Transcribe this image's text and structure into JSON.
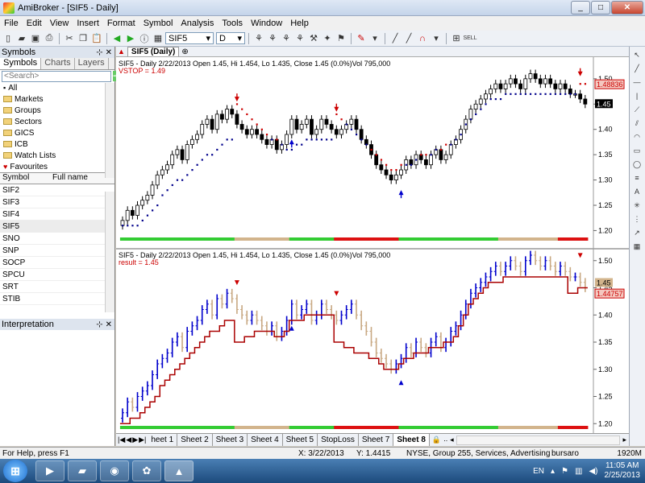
{
  "window": {
    "title": "AmiBroker - [SIF5 - Daily]"
  },
  "menu": [
    "File",
    "Edit",
    "View",
    "Insert",
    "Format",
    "Symbol",
    "Analysis",
    "Tools",
    "Window",
    "Help"
  ],
  "toolbar": {
    "symbol_value": "SIF5",
    "interval_value": "D"
  },
  "symbols_pane": {
    "title": "Symbols",
    "tabs": [
      "Symbols",
      "Charts",
      "Layers"
    ],
    "search_placeholder": "<Search>",
    "tree": [
      "All",
      "Markets",
      "Groups",
      "Sectors",
      "GICS",
      "ICB",
      "Watch Lists",
      "Favourites"
    ],
    "list_headers": [
      "Symbol",
      "Full name"
    ],
    "symbols": [
      "SIF2",
      "SIF3",
      "SIF4",
      "SIF5",
      "SNO",
      "SNP",
      "SOCP",
      "SPCU",
      "SRT",
      "STIB"
    ]
  },
  "interpretation": {
    "title": "Interpretation"
  },
  "doc_tab": "SIF5 (Daily)",
  "sheets": [
    "heet 1",
    "Sheet 2",
    "Sheet 3",
    "Sheet 4",
    "Sheet 5",
    "StopLoss",
    "Sheet 7",
    "Sheet 8"
  ],
  "status": {
    "help": "For Help, press F1",
    "x": "X: 3/22/2013",
    "y": "Y: 1.4415",
    "info": "NYSE, Group 255, Services, Advertising",
    "user": "bursaro",
    "mem": "1920M"
  },
  "taskbar": {
    "lang": "EN",
    "time": "11:05 AM",
    "date": "2/25/2013"
  },
  "colors": {
    "up": "#000000",
    "down": "#000000",
    "stop_up": "#00008b",
    "stop_down": "#cc0000",
    "arrow_up": "#0000cc",
    "arrow_down": "#cc0000",
    "result_line": "#aa0000",
    "bar_blue": "#0000cc",
    "bar_tan": "#c8a882"
  },
  "chart_data": [
    {
      "type": "candlestick",
      "title": "SIF5 - Daily 2/22/2013 Open 1.45, Hi 1.454, Lo 1.435, Close 1.45 (0.0%)Vol 795,000",
      "subtitle": "VSTOP = 1.49",
      "ylim": [
        1.18,
        1.53
      ],
      "yticks": [
        "1.50",
        "1.45",
        "1.40",
        "1.35",
        "1.30",
        "1.25",
        "1.20"
      ],
      "price_labels": [
        "1.48836",
        "1.45"
      ],
      "closes": [
        1.22,
        1.24,
        1.23,
        1.25,
        1.26,
        1.27,
        1.29,
        1.31,
        1.32,
        1.33,
        1.35,
        1.36,
        1.34,
        1.37,
        1.38,
        1.39,
        1.41,
        1.42,
        1.4,
        1.43,
        1.42,
        1.44,
        1.43,
        1.41,
        1.4,
        1.39,
        1.4,
        1.39,
        1.38,
        1.37,
        1.38,
        1.36,
        1.37,
        1.39,
        1.42,
        1.4,
        1.41,
        1.42,
        1.39,
        1.4,
        1.42,
        1.41,
        1.4,
        1.39,
        1.4,
        1.41,
        1.42,
        1.4,
        1.38,
        1.37,
        1.35,
        1.33,
        1.32,
        1.31,
        1.3,
        1.31,
        1.32,
        1.34,
        1.33,
        1.35,
        1.34,
        1.33,
        1.35,
        1.36,
        1.34,
        1.35,
        1.37,
        1.38,
        1.4,
        1.42,
        1.44,
        1.45,
        1.46,
        1.47,
        1.48,
        1.49,
        1.48,
        1.49,
        1.5,
        1.49,
        1.48,
        1.5,
        1.51,
        1.5,
        1.49,
        1.5,
        1.49,
        1.48,
        1.49,
        1.48,
        1.47,
        1.47,
        1.46,
        1.45
      ],
      "vstop_values": [
        1.21,
        1.21,
        1.21,
        1.21,
        1.22,
        1.23,
        1.24,
        1.25,
        1.27,
        1.28,
        1.29,
        1.3,
        1.3,
        1.31,
        1.32,
        1.33,
        1.34,
        1.35,
        1.35,
        1.36,
        1.37,
        1.38,
        1.38,
        1.45,
        1.44,
        1.43,
        1.42,
        1.41,
        1.4,
        1.39,
        1.38,
        1.38,
        1.37,
        1.36,
        1.36,
        1.37,
        1.37,
        1.38,
        1.38,
        1.38,
        1.38,
        1.38,
        1.38,
        1.43,
        1.42,
        1.41,
        1.4,
        1.39,
        1.38,
        1.37,
        1.36,
        1.35,
        1.34,
        1.33,
        1.32,
        1.32,
        1.33,
        1.33,
        1.33,
        1.34,
        1.35,
        1.35,
        1.35,
        1.36,
        1.36,
        1.37,
        1.37,
        1.38,
        1.39,
        1.41,
        1.42,
        1.43,
        1.44,
        1.45,
        1.46,
        1.46,
        1.46,
        1.47,
        1.47,
        1.47,
        1.47,
        1.47,
        1.47,
        1.47,
        1.47,
        1.47,
        1.47,
        1.47,
        1.47,
        1.47,
        1.47,
        1.47,
        1.49,
        1.49
      ],
      "signals": [
        {
          "i": 23,
          "dir": "sell"
        },
        {
          "i": 34,
          "dir": "buy"
        },
        {
          "i": 43,
          "dir": "sell"
        },
        {
          "i": 56,
          "dir": "buy"
        },
        {
          "i": 92,
          "dir": "sell"
        }
      ]
    },
    {
      "type": "bar",
      "title": "SIF5 - Daily 2/22/2013 Open 1.45, Hi 1.454, Lo 1.435, Close 1.45 (0.0%)Vol 795,000",
      "subtitle": "result = 1.45",
      "ylim": [
        1.19,
        1.51
      ],
      "yticks": [
        "1.50",
        "1.45",
        "1.40",
        "1.35",
        "1.30",
        "1.25",
        "1.20"
      ],
      "price_labels": [
        "1.45",
        "1.44757"
      ],
      "result_values": [
        1.2,
        1.2,
        1.21,
        1.21,
        1.22,
        1.23,
        1.24,
        1.25,
        1.27,
        1.28,
        1.29,
        1.3,
        1.31,
        1.32,
        1.33,
        1.34,
        1.35,
        1.36,
        1.37,
        1.37,
        1.38,
        1.39,
        1.39,
        1.35,
        1.35,
        1.36,
        1.36,
        1.37,
        1.37,
        1.37,
        1.37,
        1.36,
        1.36,
        1.37,
        1.39,
        1.39,
        1.39,
        1.4,
        1.4,
        1.4,
        1.4,
        1.4,
        1.4,
        1.35,
        1.35,
        1.34,
        1.34,
        1.33,
        1.33,
        1.33,
        1.32,
        1.32,
        1.31,
        1.3,
        1.3,
        1.3,
        1.31,
        1.32,
        1.32,
        1.33,
        1.33,
        1.33,
        1.34,
        1.34,
        1.34,
        1.35,
        1.35,
        1.36,
        1.38,
        1.4,
        1.42,
        1.43,
        1.44,
        1.45,
        1.46,
        1.46,
        1.46,
        1.47,
        1.47,
        1.47,
        1.47,
        1.47,
        1.47,
        1.47,
        1.47,
        1.47,
        1.47,
        1.47,
        1.47,
        1.47,
        1.44,
        1.44,
        1.45,
        1.45
      ]
    }
  ]
}
